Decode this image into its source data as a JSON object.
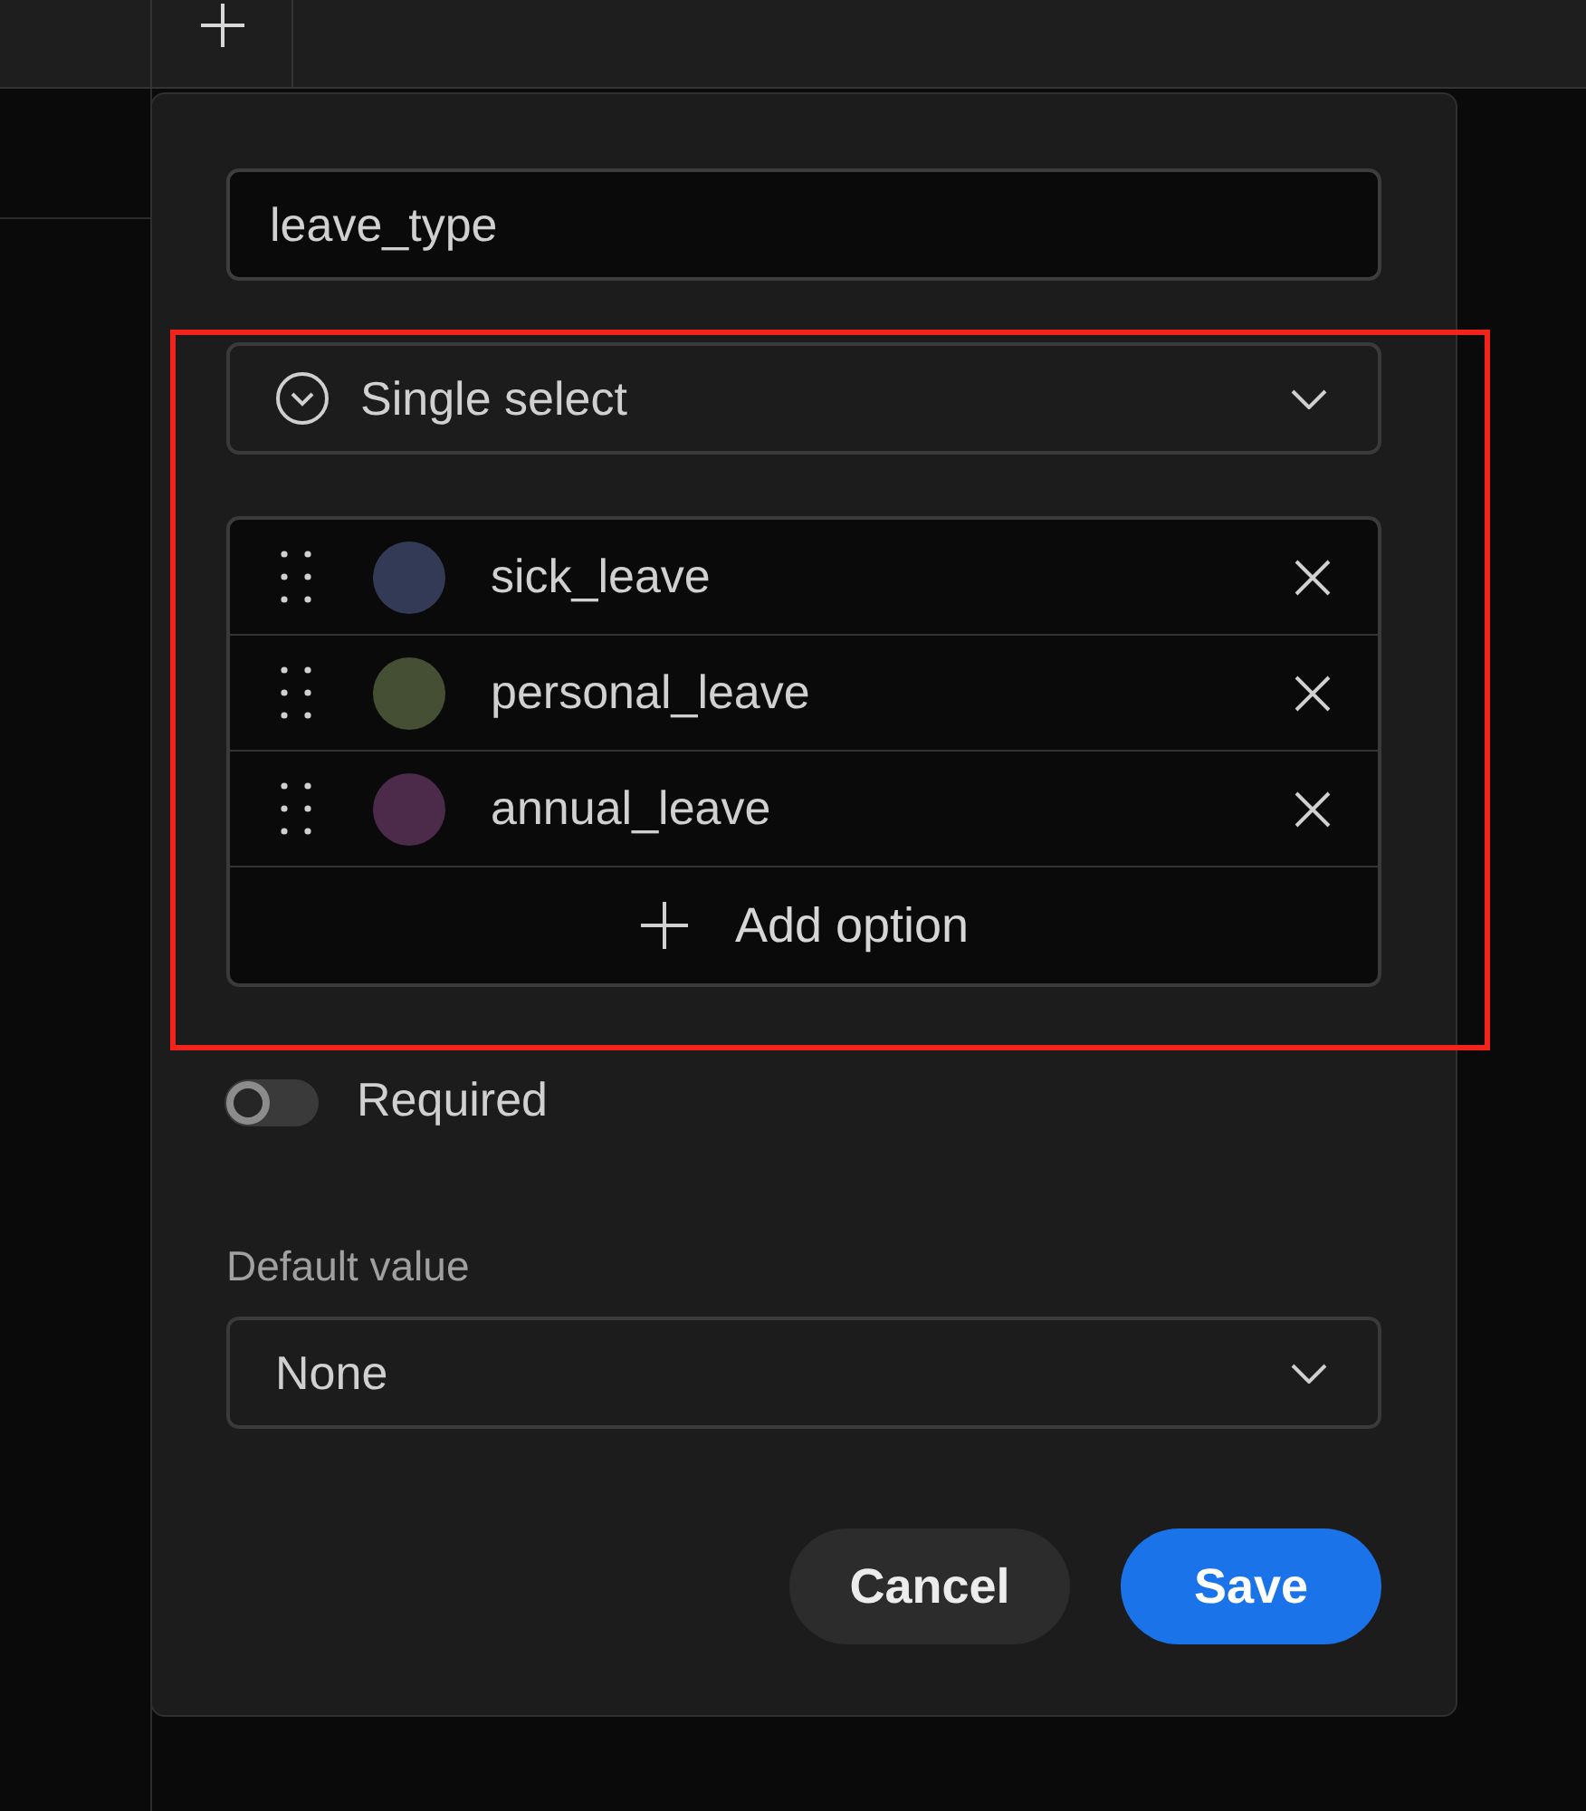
{
  "field_name": {
    "value": "leave_type"
  },
  "field_type": {
    "value": "Single select",
    "highlighted": true,
    "options": [
      {
        "label": "sick_leave",
        "color": "#323a56"
      },
      {
        "label": "personal_leave",
        "color": "#444f33"
      },
      {
        "label": "annual_leave",
        "color": "#4c2a4a"
      }
    ],
    "add_option": "Add option"
  },
  "required": {
    "label": "Required",
    "on": false
  },
  "default_value": {
    "label": "Default value",
    "value": "None"
  },
  "buttons": [
    {
      "label": "Cancel",
      "kind": "secondary"
    },
    {
      "label": "Save",
      "kind": "primary"
    }
  ]
}
